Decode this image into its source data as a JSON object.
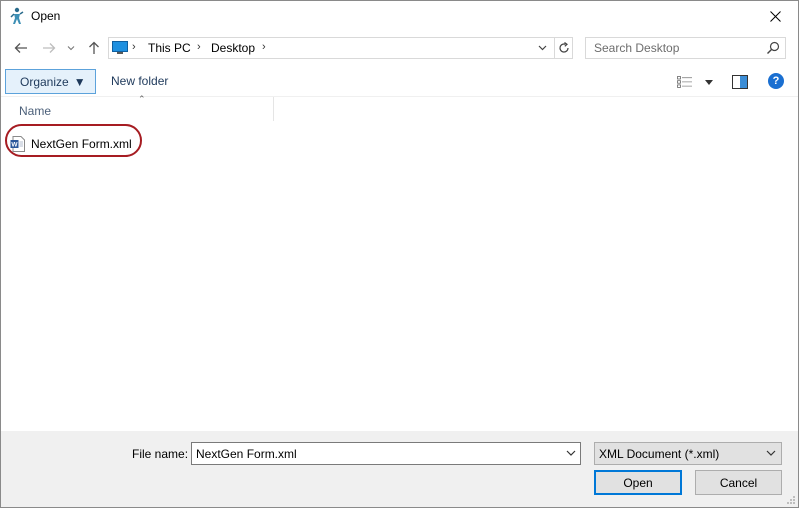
{
  "window": {
    "title": "Open"
  },
  "nav": {
    "breadcrumb": [
      "This PC",
      "Desktop"
    ],
    "search_placeholder": "Search Desktop"
  },
  "toolbar": {
    "organize_label": "Organize",
    "new_folder_label": "New folder"
  },
  "filelist": {
    "columns": [
      "Name"
    ],
    "files": [
      {
        "name": "NextGen Form.xml",
        "icon": "word-xml-document-icon"
      }
    ]
  },
  "footer": {
    "file_name_label": "File name:",
    "file_name_value": "NextGen Form.xml",
    "filter_value": "XML Document (*.xml)",
    "open_label": "Open",
    "cancel_label": "Cancel"
  },
  "colors": {
    "accent_blue": "#0078d7",
    "highlight_red": "#a61c22",
    "organize_bg": "#e5f1fb",
    "footer_bg": "#f0f0f0"
  }
}
